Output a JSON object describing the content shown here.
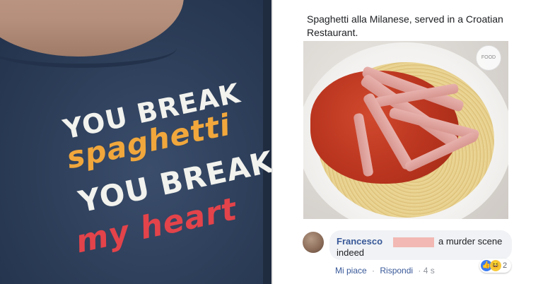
{
  "shirt": {
    "line1": "YOU BREAK",
    "line2": "spaghetti",
    "line3": "YOU BREAK",
    "line4": "my heart"
  },
  "post": {
    "caption": "Spaghetti alla Milanese, served in a Croatian Restaurant.",
    "watermark": "FOOD",
    "comment": {
      "author": "Francesco",
      "text_line1": "a murder scene",
      "text_line2": "indeed"
    },
    "actions": {
      "like": "Mi piace",
      "separator": "·",
      "reply": "Rispondi",
      "time": "· 4 s"
    },
    "reactions": {
      "count": "2",
      "types": [
        "like-icon",
        "haha-icon"
      ]
    }
  }
}
